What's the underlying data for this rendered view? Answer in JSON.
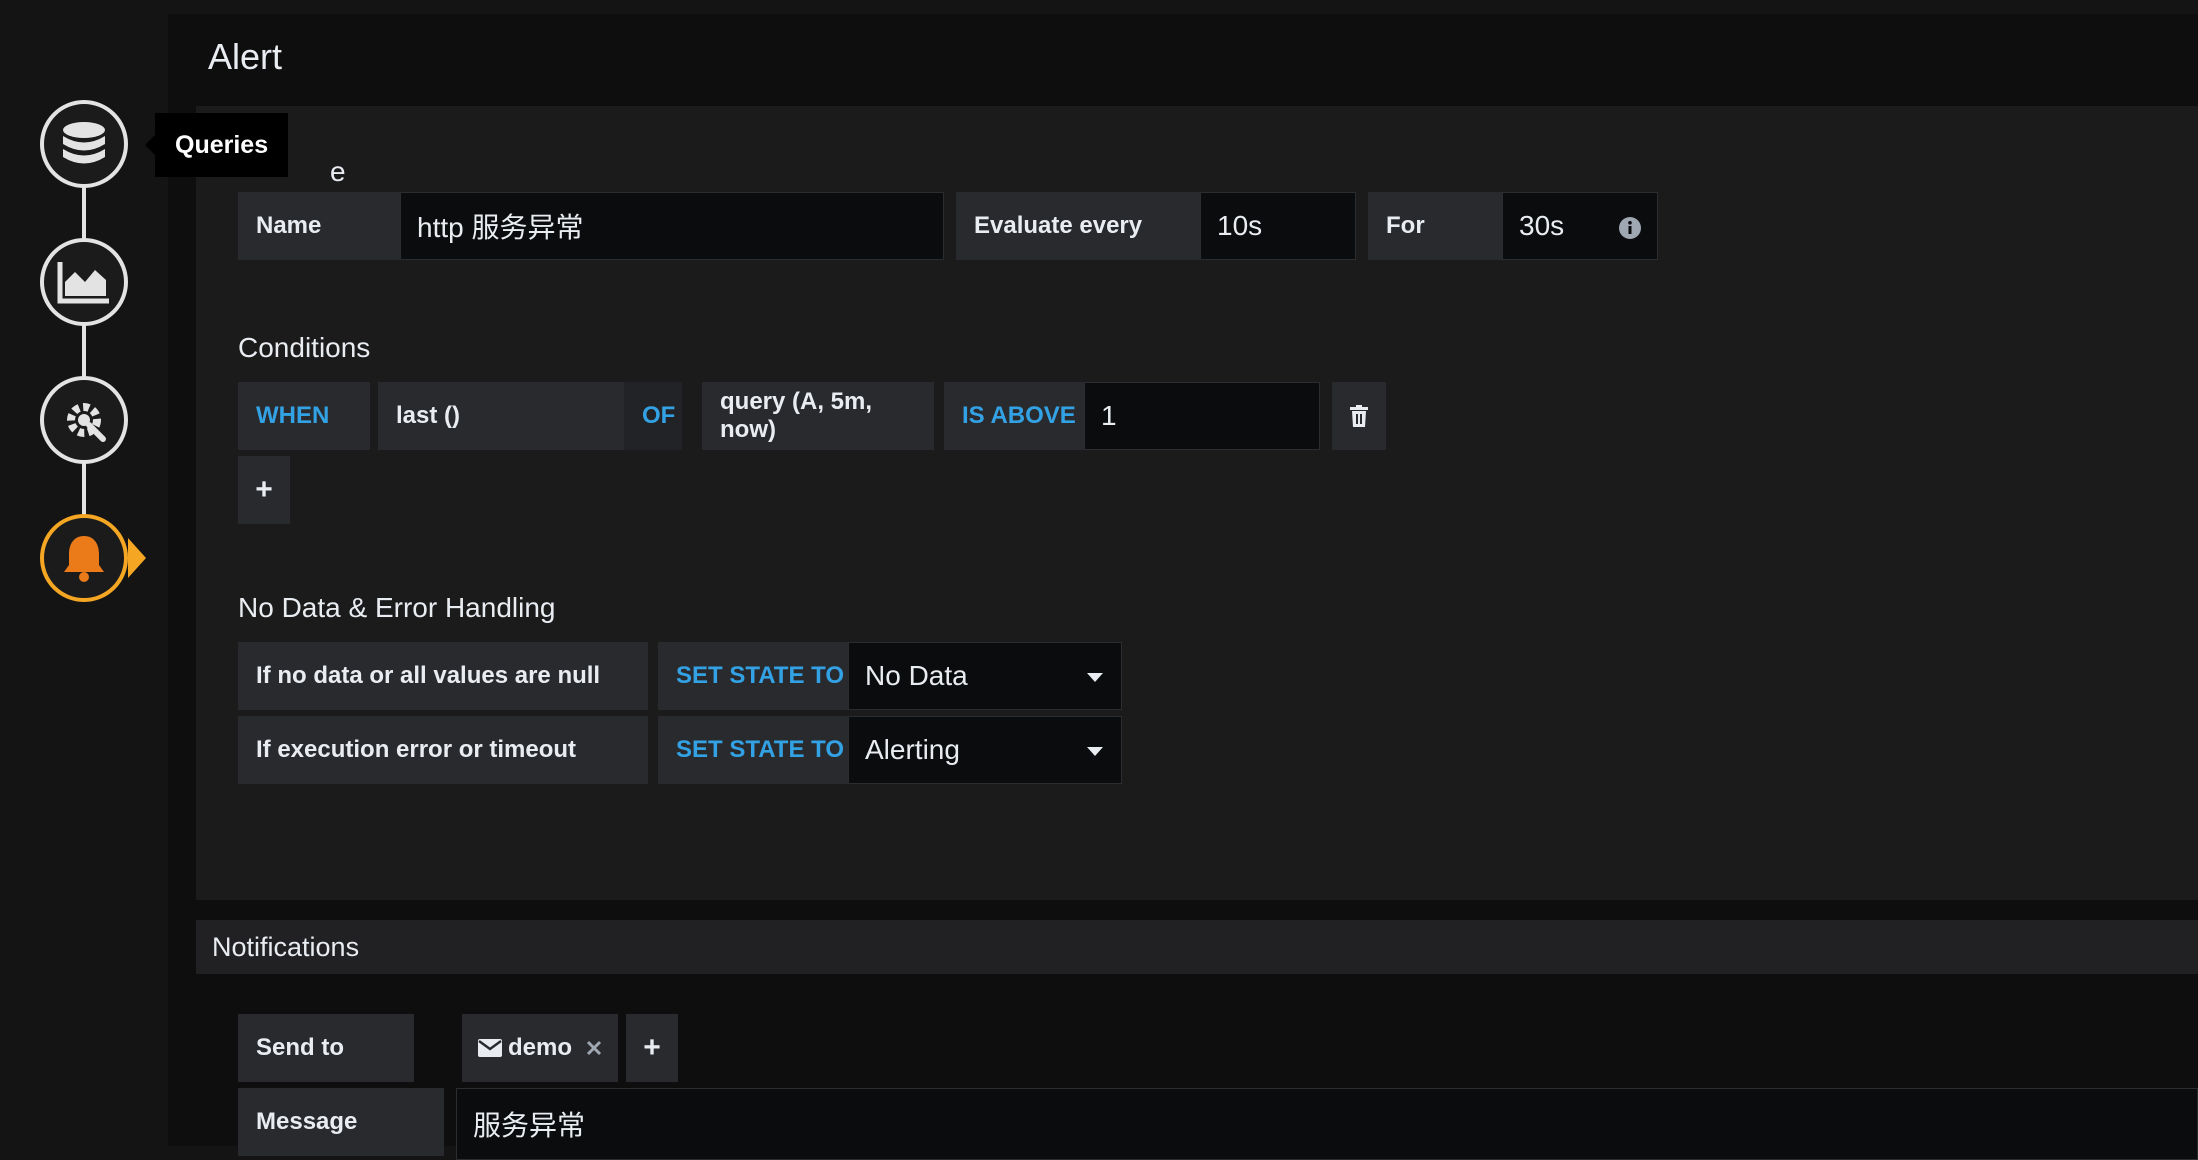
{
  "tooltip": "Queries",
  "panel": {
    "title": "Alert",
    "partial_heading_char": "e"
  },
  "rule": {
    "name_label": "Name",
    "name_value": "http 服务异常",
    "evaluate_label": "Evaluate every",
    "evaluate_value": "10s",
    "for_label": "For",
    "for_value": "30s"
  },
  "conditions": {
    "title": "Conditions",
    "when": "WHEN",
    "reducer": "last ()",
    "of": "OF",
    "query": "query (A, 5m, now)",
    "evaluator": "IS ABOVE",
    "threshold": "1",
    "add": "+"
  },
  "nodata": {
    "title": "No Data & Error Handling",
    "row1_label": "If no data or all values are null",
    "row1_set": "SET STATE TO",
    "row1_value": "No Data",
    "row2_label": "If execution error or timeout",
    "row2_set": "SET STATE TO",
    "row2_value": "Alerting"
  },
  "notifications": {
    "title": "Notifications",
    "send_to_label": "Send to",
    "target": "demo",
    "add": "+",
    "message_label": "Message",
    "message_value": "服务异常"
  },
  "colors": {
    "accent_blue": "#33a2e5",
    "active_orange": "#f5a623",
    "bell_orange": "#eb7b18"
  }
}
